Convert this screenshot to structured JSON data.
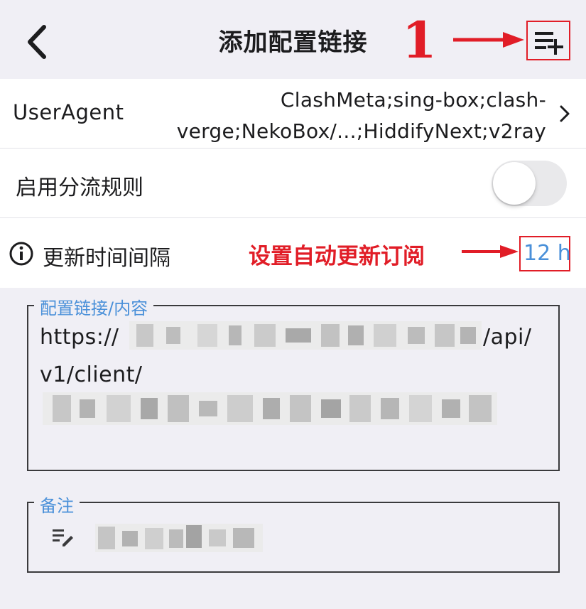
{
  "header": {
    "title": "添加配置链接",
    "back_icon": "chevron-left-icon",
    "add_icon": "playlist-add-icon"
  },
  "annotations": {
    "step_number": "1",
    "auto_update_note": "设置自动更新订阅",
    "color": "#e11d27"
  },
  "settings": {
    "user_agent": {
      "label": "UserAgent",
      "value": "ClashMeta;sing-box;clash-verge;NekoBox/...;HiddifyNext;v2ray"
    },
    "routing_rules": {
      "label": "启用分流规则",
      "enabled": false
    },
    "update_interval": {
      "label": "更新时间间隔",
      "value": "12 h"
    }
  },
  "form": {
    "link": {
      "legend": "配置链接/内容",
      "value_prefix": "https://",
      "value_mid": "/api/",
      "value_line2": "v1/client/"
    },
    "note": {
      "legend": "备注",
      "icon": "notes-edit-icon"
    }
  },
  "colors": {
    "background": "#f0eff5",
    "accent": "#4a90d9",
    "annotation_red": "#e11d27"
  }
}
